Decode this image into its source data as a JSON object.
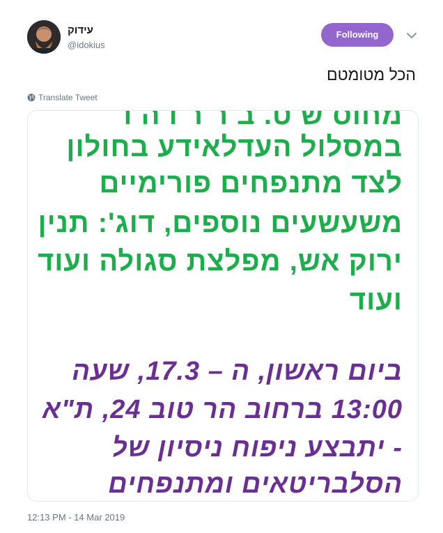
{
  "user": {
    "display_name": "עידוק",
    "handle": "@idokius"
  },
  "follow_button": {
    "label": "Following"
  },
  "tweet": {
    "text": "הכל מטומטם",
    "translate_label": "Translate Tweet",
    "timestamp": "12:13 PM - 14 Mar 2019"
  },
  "media": {
    "lines_green": [
      "מחוס ש  ט. ב  ר  ר  ו  ה  ו",
      "במסלול העדלאידע בחולון",
      "לצד מתנפחים פורימיים",
      "משעשעים נוספים, דוג': תנין",
      "ירוק אש, מפלצת סגולה ועוד",
      "ועוד"
    ],
    "lines_purple": [
      "ביום ראשון, ה – 17.3, שעה",
      "13:00 ברחוב הר טוב 24, ת\"א",
      "- יתבצע ניפוח ניסיון של",
      "הסלבריטאים ומתנפחים"
    ]
  },
  "colors": {
    "accent": "#9266cc",
    "green_text": "#1ead4c",
    "purple_text": "#6a2f92",
    "muted": "#657786"
  }
}
